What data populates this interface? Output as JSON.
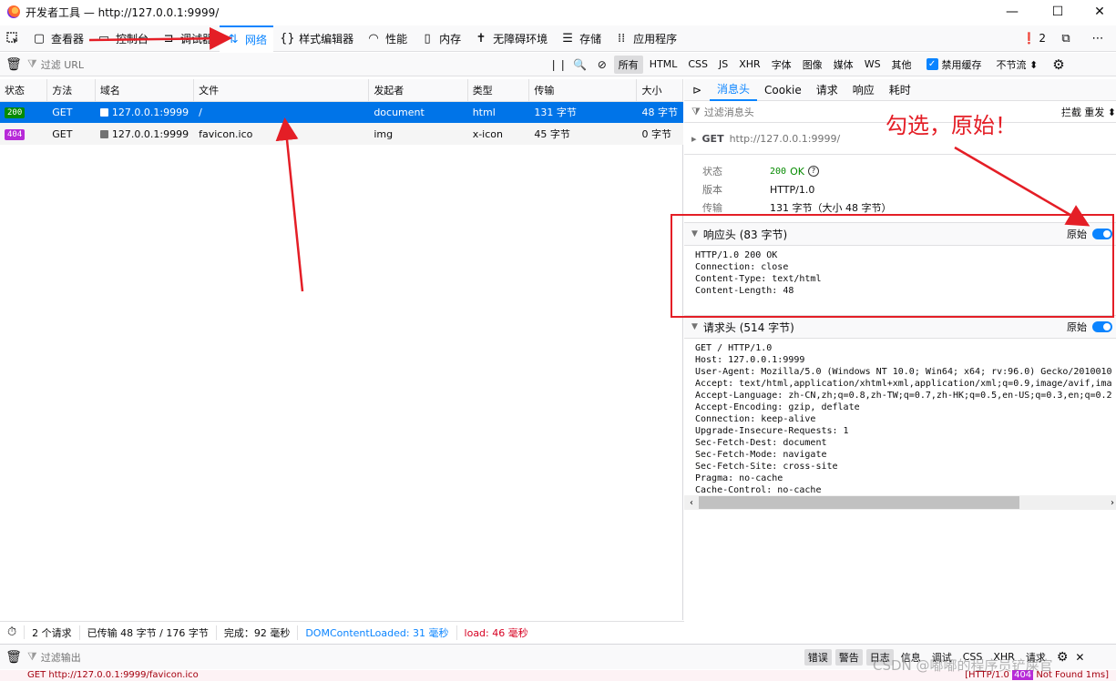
{
  "window": {
    "title": "开发者工具 — http://127.0.0.1:9999/",
    "controls": [
      "—",
      "☐",
      "✕"
    ]
  },
  "toolbox": {
    "tabs": [
      {
        "label": "查看器",
        "icon": "inspector-icon"
      },
      {
        "label": "控制台",
        "icon": "console-icon"
      },
      {
        "label": "调试器",
        "icon": "debugger-icon"
      },
      {
        "label": "网络",
        "icon": "network-icon",
        "active": true
      },
      {
        "label": "样式编辑器",
        "icon": "style-editor-icon"
      },
      {
        "label": "性能",
        "icon": "performance-icon"
      },
      {
        "label": "内存",
        "icon": "memory-icon"
      },
      {
        "label": "无障碍环境",
        "icon": "accessibility-icon"
      },
      {
        "label": "存储",
        "icon": "storage-icon"
      },
      {
        "label": "应用程序",
        "icon": "application-icon"
      }
    ],
    "error_count": "2"
  },
  "filterbar": {
    "placeholder": "过滤 URL",
    "types": [
      "所有",
      "HTML",
      "CSS",
      "JS",
      "XHR",
      "字体",
      "图像",
      "媒体",
      "WS",
      "其他"
    ],
    "disable_cache_label": "禁用缓存",
    "throttle": "不节流 ⬍"
  },
  "table": {
    "headers": [
      "状态",
      "方法",
      "域名",
      "文件",
      "发起者",
      "类型",
      "传输",
      "大小"
    ],
    "rows": [
      {
        "status": "200",
        "method": "GET",
        "domain": "127.0.0.1:9999",
        "file": "/",
        "initiator": "document",
        "type": "html",
        "transfer": "131 字节",
        "size": "48 字节"
      },
      {
        "status": "404",
        "method": "GET",
        "domain": "127.0.0.1:9999",
        "file": "favicon.ico",
        "initiator": "img",
        "type": "x-icon",
        "transfer": "45 字节",
        "size": "0 字节"
      }
    ]
  },
  "sidebar": {
    "tabs": [
      "消息头",
      "Cookie",
      "请求",
      "响应",
      "耗时"
    ],
    "filter_placeholder": "过滤消息头",
    "block_label": "拦截",
    "resend_label": "重发 ⬍",
    "request_line": "GET",
    "request_url": "http://127.0.0.1:9999/",
    "summary": {
      "status_key": "状态",
      "status_code": "200",
      "status_text": "OK",
      "version_key": "版本",
      "version_val": "HTTP/1.0",
      "transfer_key": "传输",
      "transfer_val": "131 字节（大小 48 字节）"
    },
    "response_headers": {
      "title": "响应头 (83 字节)",
      "raw_label": "原始",
      "raw": "HTTP/1.0 200 OK\nConnection: close\nContent-Type: text/html\nContent-Length: 48"
    },
    "request_headers": {
      "title": "请求头 (514 字节)",
      "raw_label": "原始",
      "raw": "GET / HTTP/1.0\nHost: 127.0.0.1:9999\nUser-Agent: Mozilla/5.0 (Windows NT 10.0; Win64; x64; rv:96.0) Gecko/2010010\nAccept: text/html,application/xhtml+xml,application/xml;q=0.9,image/avif,ima\nAccept-Language: zh-CN,zh;q=0.8,zh-TW;q=0.7,zh-HK;q=0.5,en-US;q=0.3,en;q=0.2\nAccept-Encoding: gzip, deflate\nConnection: keep-alive\nUpgrade-Insecure-Requests: 1\nSec-Fetch-Dest: document\nSec-Fetch-Mode: navigate\nSec-Fetch-Site: cross-site\nPragma: no-cache\nCache-Control: no-cache"
    }
  },
  "statusbar": {
    "requests": "2 个请求",
    "transferred": "已传输 48 字节 / 176 字节",
    "finish": "完成：92 毫秒",
    "dcl": "DOMContentLoaded: 31 毫秒",
    "load": "load: 46 毫秒"
  },
  "console": {
    "placeholder": "过滤输出",
    "types": [
      "错误",
      "警告",
      "日志",
      "信息",
      "调试",
      "CSS",
      "XHR",
      "请求"
    ],
    "line_left": "GET http://127.0.0.1:9999/favicon.ico",
    "line_right_prefix": "[HTTP/1.0",
    "line_right_code": "404",
    "line_right_suffix": "Not Found 1ms]"
  },
  "annotation": {
    "note": "勾选，原始！",
    "watermark": "CSDN @嘟嘟的程序员铲屎官"
  },
  "colors": {
    "accent": "#0a84ff",
    "selected_row": "#0074e8",
    "status_200": "#058b00",
    "status_404": "#b72ad8",
    "annotation_red": "#e41e26",
    "dcl_blue": "#0a84ff",
    "load_pink": "#d70022"
  }
}
